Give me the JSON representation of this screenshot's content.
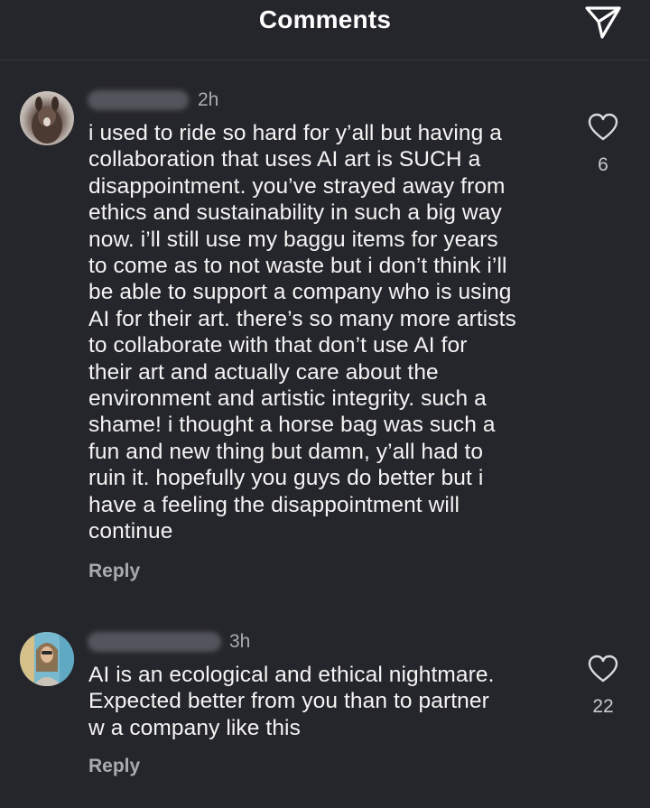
{
  "header": {
    "title": "Comments"
  },
  "comments": [
    {
      "timestamp": "2h",
      "text": "i used to ride so hard for y’all but having a\ncollaboration that uses AI art is SUCH a\ndisappointment. you’ve strayed away from\nethics and sustainability in such a big way\nnow. i’ll still use my baggu items for years\nto come as to not waste but i don’t think i’ll\nbe able to support a company who is using\nAI for their art. there’s so many more artists\nto collaborate with that don’t use AI for\ntheir art and actually care about the\nenvironment and artistic integrity. such a\nshame! i thought a horse bag was such a\nfun and new thing but damn, y’all had to\nruin it. hopefully you guys do better but i\nhave a feeling the disappointment will\ncontinue",
      "reply_label": "Reply",
      "like_count": "6"
    },
    {
      "timestamp": "3h",
      "text": "AI is an ecological and ethical nightmare.\nExpected better from you  than to partner\nw a company like this",
      "reply_label": "Reply",
      "like_count": "22"
    }
  ],
  "icons": {
    "share": "paper-plane-icon",
    "like": "heart-outline-icon"
  },
  "colors": {
    "background": "#25262b",
    "text": "#f4f4f4",
    "muted": "#a9abb1"
  }
}
